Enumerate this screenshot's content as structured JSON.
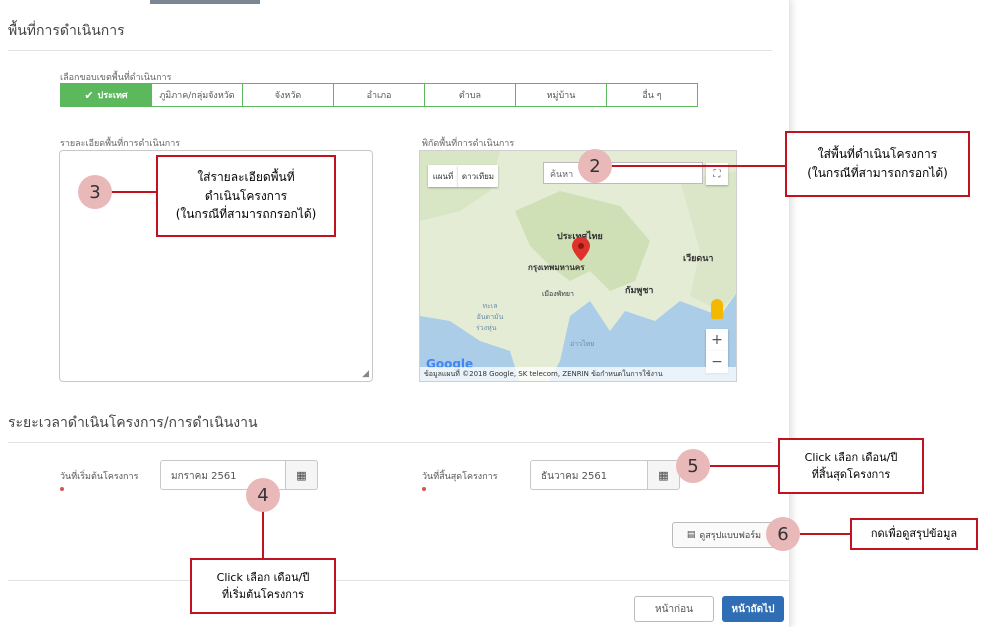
{
  "section1": {
    "title": "พื้นที่การดำเนินการ",
    "scope_label": "เลือกขอบเขตพื้นที่ดำเนินการ",
    "scope_tabs": [
      {
        "label": "ประเทศ",
        "active": true
      },
      {
        "label": "ภูมิภาค/กลุ่มจังหวัด",
        "active": false
      },
      {
        "label": "จังหวัด",
        "active": false
      },
      {
        "label": "อำเภอ",
        "active": false
      },
      {
        "label": "ตำบล",
        "active": false
      },
      {
        "label": "หมู่บ้าน",
        "active": false
      },
      {
        "label": "อื่น ๆ",
        "active": false
      }
    ],
    "details_label": "รายละเอียดพื้นที่การดำเนินการ",
    "map_label": "พิกัดพื้นที่การดำเนินการ"
  },
  "map": {
    "btn_map": "แผนที่",
    "btn_satellite": "ดาวเทียม",
    "search_placeholder": "ค้นหา",
    "country": "ประเทศไทย",
    "city": "กรุงเทพมหานคร",
    "pattaya": "เมืองพัทยา",
    "cambodia": "กัมพูชา",
    "vietnam": "เวียดนา",
    "gulf": "อ่าวไทย",
    "andaman": "ทะเลอันดามัน",
    "chao": "ร่วงหุ่น",
    "google_logo": "Google",
    "footer": "ข้อมูลแผนที่ ©2018 Google, SK telecom, ZENRIN   ข้อกำหนดในการใช้งาน",
    "zoom_in": "+",
    "zoom_out": "−"
  },
  "section2": {
    "title": "ระยะเวลาดำเนินโครงการ/การดำเนินงาน",
    "start_label": "วันที่เริ่มต้นโครงการ",
    "start_value": "มกราคม 2561",
    "end_label": "วันที่สิ้นสุดโครงการ",
    "end_value": "ธันวาคม 2561"
  },
  "buttons": {
    "summary": "ดูสรุปแบบฟอร์ม",
    "prev": "หน้าก่อน",
    "next": "หน้าถัดไป"
  },
  "callouts": {
    "c2": "ใส่พื้นที่ดำเนินโครงการ\n(ในกรณีที่สามารถกรอกได้)",
    "c3": "ใส่รายละเอียดพื้นที่\nดำเนินโครงการ\n(ในกรณีที่สามารถกรอกได้)",
    "c4": "Click เลือก เดือน/ปี\nที่เริ่มต้นโครงการ",
    "c5": "Click เลือก เดือน/ปี\nที่สิ้นสุดโครงการ",
    "c6": "กดเพื่อดูสรุปข้อมูล"
  },
  "badges": {
    "b2": "2",
    "b3": "3",
    "b4": "4",
    "b5": "5",
    "b6": "6"
  },
  "colors": {
    "green": "#5cb85c",
    "blue": "#2f6db5",
    "red": "#c0121f",
    "badge": "#e9b8b8"
  }
}
